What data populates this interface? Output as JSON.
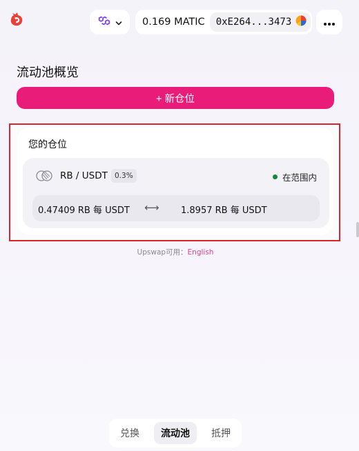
{
  "header": {
    "logo_icon": "upswap-logo-icon",
    "network": {
      "icon": "polygon-icon",
      "dropdown_icon": "chevron-down-icon"
    },
    "wallet": {
      "balance": "0.169 MATIC",
      "address": "0xE264...3473",
      "avatar_icon": "wallet-avatar-icon"
    },
    "more_icon": "more-dots-icon"
  },
  "page": {
    "title": "流动池概览",
    "new_position_label": "+ 新仓位"
  },
  "positions": {
    "title": "您的仓位",
    "items": [
      {
        "pair_icon": "pair-icon",
        "pair": "RB / USDT",
        "fee": "0.3%",
        "status": "在范围内",
        "status_color": "#0f8a3c",
        "price_min": "0.47409 RB 每 USDT",
        "arrows": "⟷",
        "price_max": "1.8957 RB 每 USDT"
      }
    ]
  },
  "footnote": {
    "text": "Upswap可用：",
    "link": "English"
  },
  "bottom_nav": {
    "tabs": [
      {
        "label": "兑换",
        "active": false
      },
      {
        "label": "流动池",
        "active": true
      },
      {
        "label": "抵押",
        "active": false
      }
    ]
  },
  "colors": {
    "accent": "#ea1c7a",
    "highlight_border": "#d9262c",
    "network_icon": "#8247e5"
  }
}
